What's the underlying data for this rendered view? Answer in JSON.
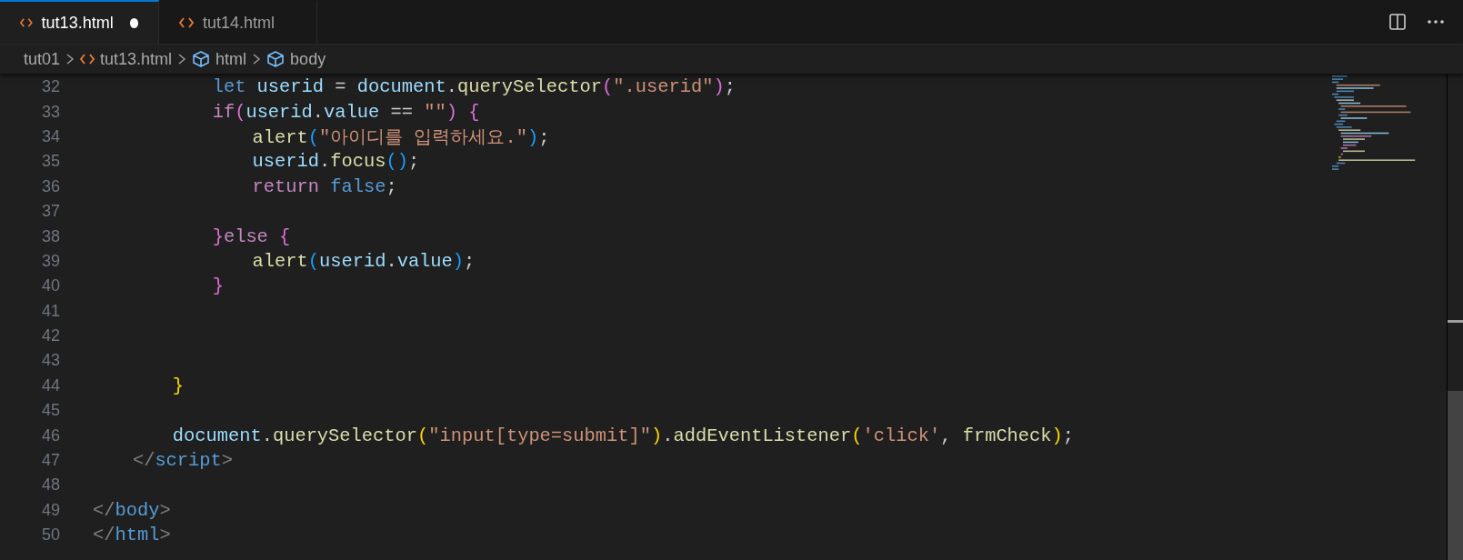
{
  "tabs": [
    {
      "label": "tut13.html",
      "selected": true,
      "modified": true
    },
    {
      "label": "tut14.html",
      "selected": false,
      "modified": false
    }
  ],
  "breadcrumbs": [
    {
      "label": "tut01",
      "kind": "folder"
    },
    {
      "label": "tut13.html",
      "kind": "file"
    },
    {
      "label": "html",
      "kind": "symbol"
    },
    {
      "label": "body",
      "kind": "symbol"
    }
  ],
  "lines": [
    {
      "number": "32",
      "tokens": [
        {
          "t": "            let ",
          "kind": "kw"
        },
        {
          "t": "userid",
          "kind": "var"
        },
        {
          "t": " = ",
          "kind": "p"
        },
        {
          "t": "document",
          "kind": "var"
        },
        {
          "t": ".",
          "kind": "p"
        },
        {
          "t": "querySelector",
          "kind": "fn"
        },
        {
          "t": "(",
          "kind": "b2"
        },
        {
          "t": "\".userid\"",
          "kind": "str"
        },
        {
          "t": ")",
          "kind": "b2"
        },
        {
          "t": ";",
          "kind": "p"
        }
      ]
    },
    {
      "number": "33",
      "tokens": [
        {
          "t": "            if",
          "kind": "ctl"
        },
        {
          "t": "(",
          "kind": "b2"
        },
        {
          "t": "userid",
          "kind": "var"
        },
        {
          "t": ".",
          "kind": "p"
        },
        {
          "t": "value",
          "kind": "var"
        },
        {
          "t": " == ",
          "kind": "p"
        },
        {
          "t": "\"\"",
          "kind": "str"
        },
        {
          "t": ") {",
          "kind": "b2"
        }
      ]
    },
    {
      "number": "34",
      "tokens": [
        {
          "t": "                alert",
          "kind": "fn"
        },
        {
          "t": "(",
          "kind": "b3"
        },
        {
          "t": "\"아이디를 입력하세요.\"",
          "kind": "str"
        },
        {
          "t": ")",
          "kind": "b3"
        },
        {
          "t": ";",
          "kind": "p"
        }
      ]
    },
    {
      "number": "35",
      "tokens": [
        {
          "t": "                userid",
          "kind": "var"
        },
        {
          "t": ".",
          "kind": "p"
        },
        {
          "t": "focus",
          "kind": "fn"
        },
        {
          "t": "()",
          "kind": "b3"
        },
        {
          "t": ";",
          "kind": "p"
        }
      ]
    },
    {
      "number": "36",
      "tokens": [
        {
          "t": "                return ",
          "kind": "ctl"
        },
        {
          "t": "false",
          "kind": "kw"
        },
        {
          "t": ";",
          "kind": "p"
        }
      ]
    },
    {
      "number": "37"
    },
    {
      "number": "38",
      "tokens": [
        {
          "t": "            }",
          "kind": "b2"
        },
        {
          "t": "else ",
          "kind": "ctl"
        },
        {
          "t": "{",
          "kind": "b2"
        }
      ]
    },
    {
      "number": "39",
      "tokens": [
        {
          "t": "                alert",
          "kind": "fn"
        },
        {
          "t": "(",
          "kind": "b3"
        },
        {
          "t": "userid",
          "kind": "var"
        },
        {
          "t": ".",
          "kind": "p"
        },
        {
          "t": "value",
          "kind": "var"
        },
        {
          "t": ")",
          "kind": "b3"
        },
        {
          "t": ";",
          "kind": "p"
        }
      ]
    },
    {
      "number": "40",
      "tokens": [
        {
          "t": "            }",
          "kind": "b2"
        }
      ]
    },
    {
      "number": "41"
    },
    {
      "number": "42"
    },
    {
      "number": "43"
    },
    {
      "number": "44",
      "tokens": [
        {
          "t": "        }",
          "kind": "b1"
        }
      ]
    },
    {
      "number": "45"
    },
    {
      "number": "46",
      "tokens": [
        {
          "t": "        document",
          "kind": "var"
        },
        {
          "t": ".",
          "kind": "p"
        },
        {
          "t": "querySelector",
          "kind": "fn"
        },
        {
          "t": "(",
          "kind": "b1"
        },
        {
          "t": "\"input[type=submit]\"",
          "kind": "str"
        },
        {
          "t": ")",
          "kind": "b1"
        },
        {
          "t": ".",
          "kind": "p"
        },
        {
          "t": "addEventListener",
          "kind": "fn"
        },
        {
          "t": "(",
          "kind": "b1"
        },
        {
          "t": "'click'",
          "kind": "str"
        },
        {
          "t": ", ",
          "kind": "p"
        },
        {
          "t": "frmCheck",
          "kind": "fn"
        },
        {
          "t": ")",
          "kind": "b1"
        },
        {
          "t": ";",
          "kind": "p"
        }
      ]
    },
    {
      "number": "47",
      "tokens": [
        {
          "t": "    </",
          "kind": "tagp"
        },
        {
          "t": "script",
          "kind": "tag"
        },
        {
          "t": ">",
          "kind": "tagp"
        }
      ]
    },
    {
      "number": "48"
    },
    {
      "number": "49",
      "tokens": [
        {
          "t": "</",
          "kind": "tagp"
        },
        {
          "t": "body",
          "kind": "tag"
        },
        {
          "t": ">",
          "kind": "tagp"
        }
      ]
    },
    {
      "number": "50",
      "tokens": [
        {
          "t": "</",
          "kind": "tagp"
        },
        {
          "t": "html",
          "kind": "tag"
        },
        {
          "t": ">",
          "kind": "tagp"
        }
      ]
    }
  ]
}
